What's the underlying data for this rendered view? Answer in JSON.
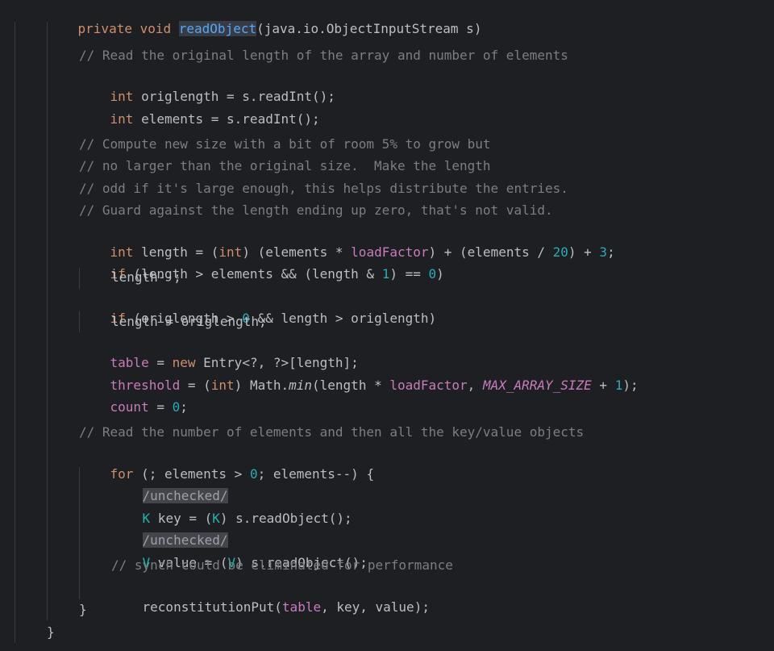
{
  "code_lines": {
    "l1": {
      "mod": "private void ",
      "method": "readObject",
      "rest": "(java.io.ObjectInputStream s)"
    },
    "l3": "// Read the original length of the array and number of elements",
    "l4": {
      "kw": "int",
      "rest": " origlength = s.readInt();"
    },
    "l5": {
      "kw": "int",
      "rest": " elements = s.readInt();"
    },
    "l7": "// Compute new size with a bit of room 5% to grow but",
    "l8": "// no larger than the original size.  Make the length",
    "l9": "// odd if it's large enough, this helps distribute the entries.",
    "l10": "// Guard against the length ending up zero, that's not valid.",
    "l11": {
      "kw": "int",
      "a": " length = (",
      "kw2": "int",
      "b": ") (elements * ",
      "fld": "loadFactor",
      "c": ") + (elements / ",
      "n1": "20",
      "d": ") + ",
      "n2": "3",
      "e": ";"
    },
    "l12": {
      "kw": "if",
      "a": " (length > elements && (length & ",
      "n1": "1",
      "b": ") == ",
      "n2": "0",
      "c": ")"
    },
    "l13": "length--;",
    "l14": {
      "kw": "if",
      "a": " (origlength > ",
      "n1": "0",
      "b": " && length > origlength)"
    },
    "l15": "length = origlength;",
    "l16": {
      "fld": "table",
      "a": " = ",
      "kw": "new",
      "b": " Entry<?, ?>[length];"
    },
    "l17": {
      "fld": "threshold",
      "a": " = (",
      "kw": "int",
      "b": ") Math.",
      "m": "min",
      "c": "(length * ",
      "fld2": "loadFactor",
      "d": ", ",
      "const": "MAX_ARRAY_SIZE",
      "e": " + ",
      "n1": "1",
      "f": ");"
    },
    "l18": {
      "fld": "count",
      "a": " = ",
      "n1": "0",
      "b": ";"
    },
    "l20": "// Read the number of elements and then all the key/value objects",
    "l21": {
      "kw": "for",
      "a": " (; elements > ",
      "n1": "0",
      "b": "; elements--) {"
    },
    "l22": "/unchecked/",
    "l23": {
      "t1": "K",
      "a": " key = (",
      "t2": "K",
      "b": ") s.readObject();"
    },
    "l24": "/unchecked/",
    "l25": {
      "t1": "V",
      "a": " value = (",
      "t2": "V",
      "b": ") s.readObject();"
    },
    "l26": "// synch could be eliminated for performance",
    "l27": {
      "a": "reconstitutionPut(",
      "fld": "table",
      "b": ", key, value);"
    },
    "l28": "}",
    "l29": "}"
  },
  "colors": {
    "background": "#1e1f22",
    "keyword": "#cf8e6d",
    "comment": "#7a7e85",
    "field": "#c77dbb",
    "number": "#2aacb8",
    "method": "#56a8f5"
  }
}
